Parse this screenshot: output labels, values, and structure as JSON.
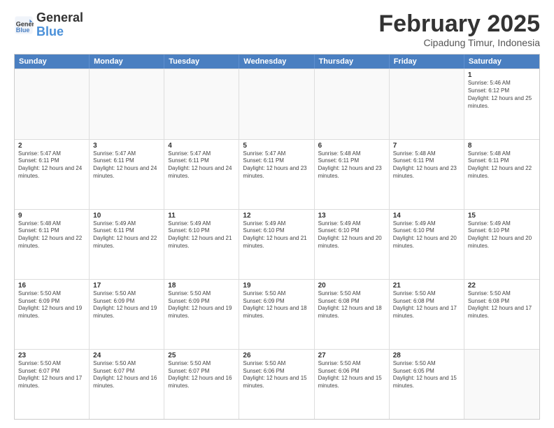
{
  "logo": {
    "line1": "General",
    "line2": "Blue"
  },
  "title": "February 2025",
  "subtitle": "Cipadung Timur, Indonesia",
  "headers": [
    "Sunday",
    "Monday",
    "Tuesday",
    "Wednesday",
    "Thursday",
    "Friday",
    "Saturday"
  ],
  "rows": [
    [
      {
        "day": "",
        "info": ""
      },
      {
        "day": "",
        "info": ""
      },
      {
        "day": "",
        "info": ""
      },
      {
        "day": "",
        "info": ""
      },
      {
        "day": "",
        "info": ""
      },
      {
        "day": "",
        "info": ""
      },
      {
        "day": "1",
        "info": "Sunrise: 5:46 AM\nSunset: 6:12 PM\nDaylight: 12 hours and 25 minutes."
      }
    ],
    [
      {
        "day": "2",
        "info": "Sunrise: 5:47 AM\nSunset: 6:11 PM\nDaylight: 12 hours and 24 minutes."
      },
      {
        "day": "3",
        "info": "Sunrise: 5:47 AM\nSunset: 6:11 PM\nDaylight: 12 hours and 24 minutes."
      },
      {
        "day": "4",
        "info": "Sunrise: 5:47 AM\nSunset: 6:11 PM\nDaylight: 12 hours and 24 minutes."
      },
      {
        "day": "5",
        "info": "Sunrise: 5:47 AM\nSunset: 6:11 PM\nDaylight: 12 hours and 23 minutes."
      },
      {
        "day": "6",
        "info": "Sunrise: 5:48 AM\nSunset: 6:11 PM\nDaylight: 12 hours and 23 minutes."
      },
      {
        "day": "7",
        "info": "Sunrise: 5:48 AM\nSunset: 6:11 PM\nDaylight: 12 hours and 23 minutes."
      },
      {
        "day": "8",
        "info": "Sunrise: 5:48 AM\nSunset: 6:11 PM\nDaylight: 12 hours and 22 minutes."
      }
    ],
    [
      {
        "day": "9",
        "info": "Sunrise: 5:48 AM\nSunset: 6:11 PM\nDaylight: 12 hours and 22 minutes."
      },
      {
        "day": "10",
        "info": "Sunrise: 5:49 AM\nSunset: 6:11 PM\nDaylight: 12 hours and 22 minutes."
      },
      {
        "day": "11",
        "info": "Sunrise: 5:49 AM\nSunset: 6:10 PM\nDaylight: 12 hours and 21 minutes."
      },
      {
        "day": "12",
        "info": "Sunrise: 5:49 AM\nSunset: 6:10 PM\nDaylight: 12 hours and 21 minutes."
      },
      {
        "day": "13",
        "info": "Sunrise: 5:49 AM\nSunset: 6:10 PM\nDaylight: 12 hours and 20 minutes."
      },
      {
        "day": "14",
        "info": "Sunrise: 5:49 AM\nSunset: 6:10 PM\nDaylight: 12 hours and 20 minutes."
      },
      {
        "day": "15",
        "info": "Sunrise: 5:49 AM\nSunset: 6:10 PM\nDaylight: 12 hours and 20 minutes."
      }
    ],
    [
      {
        "day": "16",
        "info": "Sunrise: 5:50 AM\nSunset: 6:09 PM\nDaylight: 12 hours and 19 minutes."
      },
      {
        "day": "17",
        "info": "Sunrise: 5:50 AM\nSunset: 6:09 PM\nDaylight: 12 hours and 19 minutes."
      },
      {
        "day": "18",
        "info": "Sunrise: 5:50 AM\nSunset: 6:09 PM\nDaylight: 12 hours and 19 minutes."
      },
      {
        "day": "19",
        "info": "Sunrise: 5:50 AM\nSunset: 6:09 PM\nDaylight: 12 hours and 18 minutes."
      },
      {
        "day": "20",
        "info": "Sunrise: 5:50 AM\nSunset: 6:08 PM\nDaylight: 12 hours and 18 minutes."
      },
      {
        "day": "21",
        "info": "Sunrise: 5:50 AM\nSunset: 6:08 PM\nDaylight: 12 hours and 17 minutes."
      },
      {
        "day": "22",
        "info": "Sunrise: 5:50 AM\nSunset: 6:08 PM\nDaylight: 12 hours and 17 minutes."
      }
    ],
    [
      {
        "day": "23",
        "info": "Sunrise: 5:50 AM\nSunset: 6:07 PM\nDaylight: 12 hours and 17 minutes."
      },
      {
        "day": "24",
        "info": "Sunrise: 5:50 AM\nSunset: 6:07 PM\nDaylight: 12 hours and 16 minutes."
      },
      {
        "day": "25",
        "info": "Sunrise: 5:50 AM\nSunset: 6:07 PM\nDaylight: 12 hours and 16 minutes."
      },
      {
        "day": "26",
        "info": "Sunrise: 5:50 AM\nSunset: 6:06 PM\nDaylight: 12 hours and 15 minutes."
      },
      {
        "day": "27",
        "info": "Sunrise: 5:50 AM\nSunset: 6:06 PM\nDaylight: 12 hours and 15 minutes."
      },
      {
        "day": "28",
        "info": "Sunrise: 5:50 AM\nSunset: 6:05 PM\nDaylight: 12 hours and 15 minutes."
      },
      {
        "day": "",
        "info": ""
      }
    ]
  ]
}
